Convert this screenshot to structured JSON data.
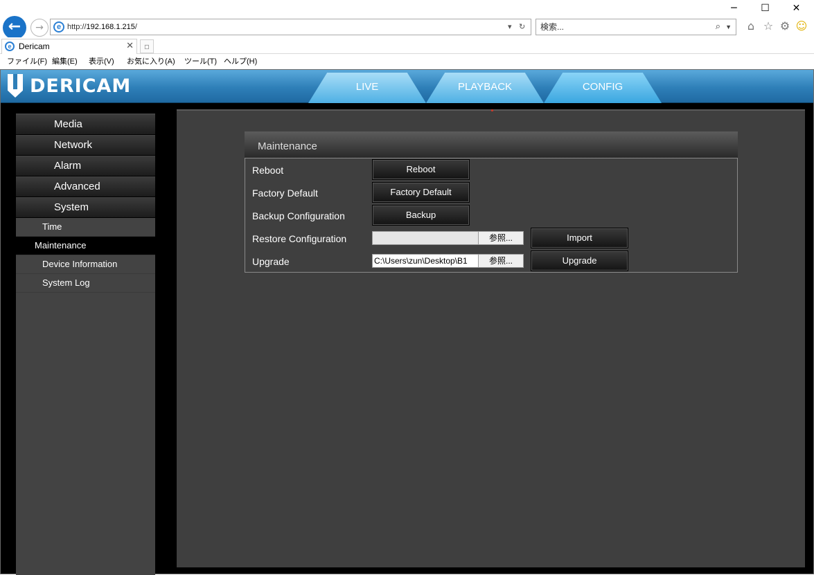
{
  "browser": {
    "url_scheme": "http://",
    "url_host": "192.168.1.215",
    "url_path": "/",
    "search_placeholder": "検索...",
    "tab_title": "Dericam",
    "menu": [
      "ファイル(F)",
      "編集(E)",
      "表示(V)",
      "お気に入り(A)",
      "ツール(T)",
      "ヘルプ(H)"
    ]
  },
  "app": {
    "logo_text": "DERICAM",
    "nav_tabs": [
      "LIVE",
      "PLAYBACK",
      "CONFIG"
    ],
    "active_tab": "CONFIG"
  },
  "sidebar": {
    "main_menus": [
      "Media",
      "Network",
      "Alarm",
      "Advanced",
      "System"
    ],
    "sub_menus": [
      "Time",
      "Maintenance",
      "Device Information",
      "System Log"
    ],
    "selected_sub": "Maintenance"
  },
  "panel": {
    "title": "Maintenance",
    "rows": {
      "reboot": {
        "label": "Reboot",
        "button": "Reboot"
      },
      "factory": {
        "label": "Factory Default",
        "button": "Factory Default"
      },
      "backup": {
        "label": "Backup Configuration",
        "button": "Backup"
      },
      "restore": {
        "label": "Restore Configuration",
        "file_value": "",
        "browse": "参照...",
        "button": "Import"
      },
      "upgrade": {
        "label": "Upgrade",
        "file_value": "C:\\Users\\zun\\Desktop\\B1",
        "browse": "参照...",
        "button": "Upgrade"
      }
    }
  },
  "colors": {
    "header_blue": "#2e7fb8",
    "content_bg": "#3f3f3f",
    "sidebar_bg": "#434343"
  }
}
